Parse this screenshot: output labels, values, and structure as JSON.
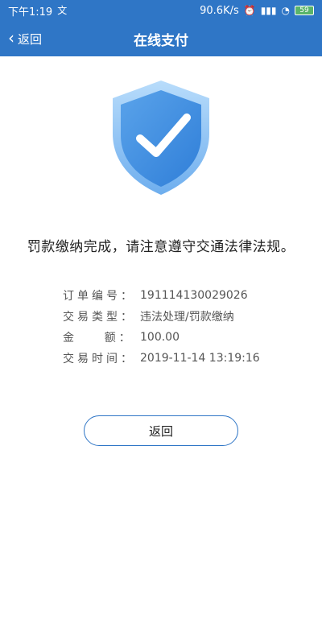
{
  "status_bar": {
    "time": "下午1:19",
    "notification_icon": "文",
    "network_speed": "90.6K/s",
    "battery": "59"
  },
  "nav": {
    "back_label": "返回",
    "title": "在线支付"
  },
  "success": {
    "message": "罚款缴纳完成，请注意遵守交通法律法规。"
  },
  "order": {
    "rows": [
      {
        "label": "订单编号：",
        "value": "191114130029026"
      },
      {
        "label": "交易类型：",
        "value": "违法处理/罚款缴纳"
      },
      {
        "label": "金    额：",
        "value": "100.00"
      },
      {
        "label": "交易时间：",
        "value": "2019-11-14 13:19:16"
      }
    ]
  },
  "actions": {
    "back_button": "返回"
  },
  "colors": {
    "primary": "#2f76c6",
    "shield_light": "#8fc3f3",
    "shield_dark": "#3f8fe0"
  }
}
